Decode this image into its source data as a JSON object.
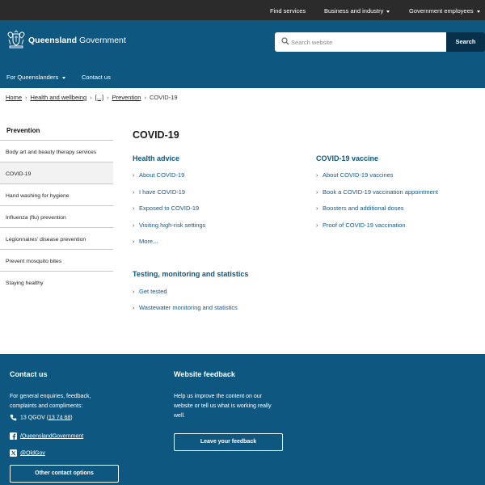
{
  "topbar": {
    "find_services": "Find services",
    "business": "Business and industry",
    "gov_employees": "Government employees"
  },
  "header": {
    "brand_bold": "Queensland",
    "brand_rest": " Government",
    "search_placeholder": "Search website",
    "search_button": "Search",
    "nav": {
      "for_qlders": "For Queenslanders",
      "contact": "Contact us"
    }
  },
  "breadcrumb": {
    "home": "Home",
    "health": "Health and wellbeing",
    "ellipsis": "[...]",
    "prevention": "Prevention",
    "current": "COVID-19"
  },
  "sidebar": {
    "title": "Prevention",
    "items": [
      "Body art and beauty therapy services",
      "COVID-19",
      "Hand washing for hygiene",
      "Influenza (flu) prevention",
      "Legionnaires' disease prevention",
      "Prevent mosquito bites",
      "Staying healthy"
    ]
  },
  "main": {
    "title": "COVID-19",
    "health_advice": {
      "heading": "Health advice",
      "links": [
        "About COVID-19",
        "I have COVID-19",
        "Exposed to COVID-19",
        "Visiting high-risk settings",
        "More..."
      ]
    },
    "vaccine": {
      "heading": "COVID-19 vaccine",
      "links": [
        "About COVID-19 vaccines",
        "Book a COVID-19 vaccination appointment",
        "Boosters and additional doses",
        "Proof of COVID-19 vaccination"
      ]
    },
    "testing": {
      "heading": "Testing, monitoring and statistics",
      "links": [
        "Get tested",
        "Wastewater monitoring and statistics"
      ]
    }
  },
  "footer": {
    "contact": {
      "heading": "Contact us",
      "text": "For general enquiries, feedback, complaints and compliments:",
      "phone_prefix": "13 QGOV (",
      "phone_link": "13 74 68",
      "phone_suffix": ")",
      "facebook": "/QueenslandGovernment",
      "x": "@QldGov",
      "button": "Other contact options"
    },
    "feedback": {
      "heading": "Website feedback",
      "text": "Help us improve the content on our website or tell us what is working really well.",
      "button": "Leave your feedback"
    }
  },
  "colors": {
    "brand_blue": "#0e5780",
    "topbar": "#2b2b2b",
    "search_button": "#09304a",
    "link": "#13578b"
  }
}
